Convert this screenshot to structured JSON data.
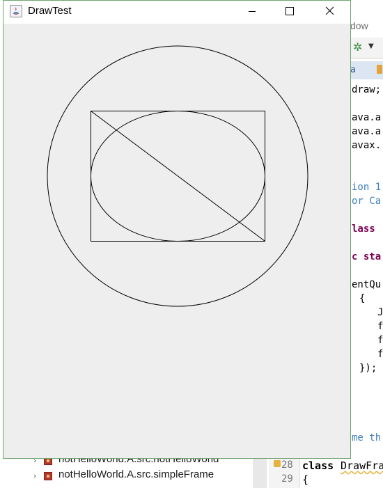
{
  "background_ide": {
    "menu_fragment": "dow",
    "tab_fragment": "a",
    "code_fragments": [
      {
        "text": "draw;",
        "kind": "plain"
      },
      {
        "text": "ava.a",
        "kind": "plain"
      },
      {
        "text": "ava.a",
        "kind": "plain"
      },
      {
        "text": "avax.",
        "kind": "plain"
      },
      {
        "text": "ion 1",
        "kind": "comment"
      },
      {
        "text": "or Ca",
        "kind": "comment"
      },
      {
        "text": "lass",
        "kind": "keyword"
      },
      {
        "text": "c sta",
        "kind": "keyword"
      },
      {
        "text": "entQu",
        "kind": "plain"
      },
      {
        "text": "{",
        "kind": "plain"
      },
      {
        "text": "J",
        "kind": "plain"
      },
      {
        "text": "f",
        "kind": "plain"
      },
      {
        "text": "f",
        "kind": "plain"
      },
      {
        "text": "f",
        "kind": "plain"
      },
      {
        "text": "});",
        "kind": "plain"
      },
      {
        "text": "me th",
        "kind": "comment"
      }
    ],
    "package_tree": [
      "notHelloWorld.A.src.notHelloWorld",
      "notHelloWorld.A.src.simpleFrame"
    ],
    "line_numbers": [
      "28",
      "29"
    ],
    "bottom_code": {
      "keyword": "class",
      "name": "DrawFra",
      "brace": "{"
    }
  },
  "window": {
    "title": "DrawTest",
    "controls": [
      "minimize",
      "maximize",
      "close"
    ],
    "client_background": "#eeeeee",
    "stroke_color": "#000000"
  }
}
